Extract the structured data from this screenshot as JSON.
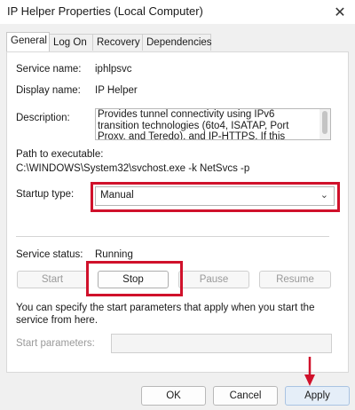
{
  "window": {
    "title": "IP Helper Properties (Local Computer)",
    "close_glyph": "✕"
  },
  "tabs": [
    {
      "label": "General",
      "active": true
    },
    {
      "label": "Log On",
      "active": false
    },
    {
      "label": "Recovery",
      "active": false
    },
    {
      "label": "Dependencies",
      "active": false
    }
  ],
  "general": {
    "service_name_label": "Service name:",
    "service_name_value": "iphlpsvc",
    "display_name_label": "Display name:",
    "display_name_value": "IP Helper",
    "description_label": "Description:",
    "description_value": "Provides tunnel connectivity using IPv6 transition technologies (6to4, ISATAP, Port Proxy, and Teredo), and IP-HTTPS. If this service is stopped",
    "path_label": "Path to executable:",
    "path_value": "C:\\WINDOWS\\System32\\svchost.exe -k NetSvcs -p",
    "startup_type_label": "Startup type:",
    "startup_type_value": "Manual",
    "service_status_label": "Service status:",
    "service_status_value": "Running",
    "buttons": {
      "start": "Start",
      "stop": "Stop",
      "pause": "Pause",
      "resume": "Resume"
    },
    "info_text": "You can specify the start parameters that apply when you start the service from here.",
    "start_params_label": "Start parameters:",
    "start_params_value": ""
  },
  "footer": {
    "ok": "OK",
    "cancel": "Cancel",
    "apply": "Apply"
  },
  "colors": {
    "highlight": "#d0112b",
    "arrow": "#d0112b"
  },
  "icons": {
    "close": "close-icon",
    "dropdown": "chevron-down-icon",
    "pointer": "red-arrow-icon"
  }
}
